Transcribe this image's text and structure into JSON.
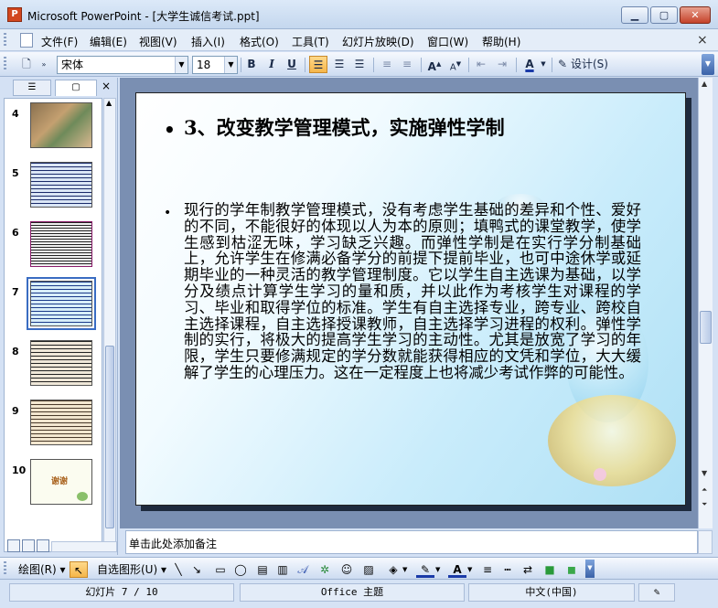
{
  "window": {
    "title": "Microsoft PowerPoint - [大学生诚信考试.ppt]",
    "min": "▁",
    "max": "▢",
    "close": "✕"
  },
  "menu": [
    {
      "name": "file",
      "label": "文件(F)"
    },
    {
      "name": "edit",
      "label": "编辑(E)"
    },
    {
      "name": "view",
      "label": "视图(V)"
    },
    {
      "name": "insert",
      "label": "插入(I)"
    },
    {
      "name": "format",
      "label": "格式(O)"
    },
    {
      "name": "tools",
      "label": "工具(T)"
    },
    {
      "name": "slideshow",
      "label": "幻灯片放映(D)"
    },
    {
      "name": "window",
      "label": "窗口(W)"
    },
    {
      "name": "help",
      "label": "帮助(H)"
    }
  ],
  "menu_close": "×",
  "toolbar": {
    "font_name": "宋体",
    "font_size": "18",
    "bold": "B",
    "italic": "I",
    "underline": "U",
    "design_label": "设计(S)",
    "accent": "#f5b64a"
  },
  "thumbnails": [
    {
      "num": "4"
    },
    {
      "num": "5"
    },
    {
      "num": "6"
    },
    {
      "num": "7"
    },
    {
      "num": "8"
    },
    {
      "num": "9"
    },
    {
      "num": "10",
      "text": "谢谢"
    }
  ],
  "slide": {
    "title": "3、改变教学管理模式，实施弹性学制",
    "body": "现行的学年制教学管理模式，没有考虑学生基础的差异和个性、爱好的不同，不能很好的体现以人为本的原则；填鸭式的课堂教学，使学生感到枯涩无味，学习缺乏兴趣。而弹性学制是在实行学分制基础上，允许学生在修满必备学分的前提下提前毕业，也可中途休学或延期毕业的一种灵活的教学管理制度。它以学生自主选课为基础，以学分及绩点计算学生学习的量和质，并以此作为考核学生对课程的学习、毕业和取得学位的标准。学生有自主选择专业，跨专业、跨校自主选择课程，自主选择授课教师，自主选择学习进程的权利。弹性学制的实行，将极大的提高学生学习的主动性。尤其是放宽了学习的年限，学生只要修满规定的学分数就能获得相应的文凭和学位，大大缓解了学生的心理压力。这在一定程度上也将减少考试作弊的可能性。"
  },
  "notes_placeholder": "单击此处添加备注",
  "drawbar": {
    "draw_label": "绘图(R)",
    "autoshapes_label": "自选图形(U)"
  },
  "status": {
    "slide_pos": "幻灯片 7 / 10",
    "theme": "Office 主题",
    "language": "中文(中国)"
  }
}
